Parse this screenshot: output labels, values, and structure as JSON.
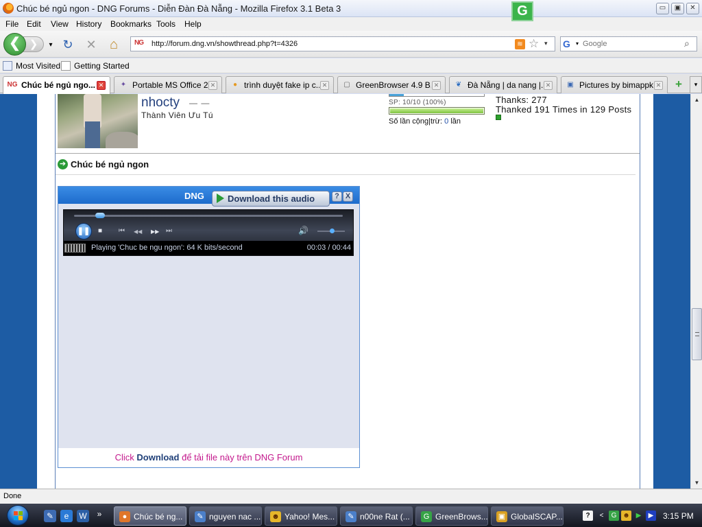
{
  "window": {
    "title": "Chúc bé ngủ ngon - DNG Forums - Diễn Đàn Đà Nẵng - Mozilla Firefox 3.1 Beta 3",
    "badge": "G",
    "min_label": "▭",
    "max_label": "▣",
    "close_label": "✕"
  },
  "menu": [
    "File",
    "Edit",
    "View",
    "History",
    "Bookmarks",
    "Tools",
    "Help"
  ],
  "nav": {
    "back_icon": "❮",
    "forward_icon": "❯",
    "dropdown_icon": "▾",
    "reload_icon": "↻",
    "stop_icon": "✕",
    "home_icon": "⌂",
    "site_icon_text": "NG",
    "url": "http://forum.dng.vn/showthread.php?t=4326",
    "rss_icon": "≋",
    "star_icon": "☆",
    "search_placeholder": "Google",
    "search_engine_icon": "G",
    "search_icon": "⌕"
  },
  "bookmarks": [
    "Most Visited",
    "Getting Started"
  ],
  "tabs": [
    {
      "label": "Chúc bé ngủ ngo...",
      "icon": "NG",
      "active": true
    },
    {
      "label": "Portable MS Office 2...",
      "icon": "✦"
    },
    {
      "label": "trình duyệt fake ip c...",
      "icon": "●"
    },
    {
      "label": "GreenBrowser 4.9 B...",
      "icon": "▢"
    },
    {
      "label": "Đà Nẵng | da nang |...",
      "icon": "❦"
    },
    {
      "label": "Pictures by bimappk ...",
      "icon": "▣"
    }
  ],
  "tab_close": "✕",
  "new_tab_icon": "+",
  "tab_list_icon": "▾",
  "post": {
    "username": "nhocty",
    "username_dash": "— —",
    "user_title": "Thành Viên Ưu Tú",
    "sp_label": "SP: 10/10 (100%)",
    "sp_fraction": 1.0,
    "top_bar_fraction": 0.15,
    "solan_label": "Số lần cộng|trừ:",
    "solan_value": "0",
    "solan_unit": "lần",
    "thanks": "Thanks: 277",
    "thanked": "Thanked 191 Times in 129 Posts",
    "title_icon": "➔",
    "title": "Chúc bé ngủ ngon"
  },
  "player": {
    "brand": "DNG",
    "download_label": "Download this audio",
    "help_label": "?",
    "close_label": "X",
    "pause_icon": "❚❚",
    "stop_icon": "■",
    "prev_icon": "⏮",
    "rewind_icon": "◀◀",
    "ffwd_icon": "▶▶",
    "next_icon": "⏭",
    "volume_icon": "🔊",
    "seek_fraction": 0.08,
    "volume_fraction": 0.55,
    "status_text": "Playing 'Chuc be ngu ngon': 64 K bits/second",
    "time": "00:03 / 00:44",
    "footer_click": "Click",
    "footer_download": "Download",
    "footer_rest": "để tải file này trên DNG Forum"
  },
  "scrollbar": {
    "up_icon": "▲",
    "down_icon": "▼"
  },
  "status": "Done",
  "taskbar": {
    "quicklaunch": [
      "✎",
      "e",
      "W",
      "»"
    ],
    "tasks": [
      {
        "label": "Chúc bé ng...",
        "icon": "●",
        "active": true
      },
      {
        "label": "nguyen nac ...",
        "icon": "✎"
      },
      {
        "label": "Yahoo! Mes...",
        "icon": "☻"
      },
      {
        "label": "n00ne Rat (...",
        "icon": "✎"
      },
      {
        "label": "GreenBrows...",
        "icon": "G"
      },
      {
        "label": "GlobalSCAP...",
        "icon": "▣"
      }
    ],
    "tray_icons": [
      "?",
      "<",
      "G",
      "☻",
      "▶",
      "▶"
    ],
    "clock": "3:15 PM"
  },
  "colors": {
    "forum_blue": "#1d5ca4",
    "player_header": "#2a7bd8",
    "footer_magenta": "#c3188c"
  }
}
